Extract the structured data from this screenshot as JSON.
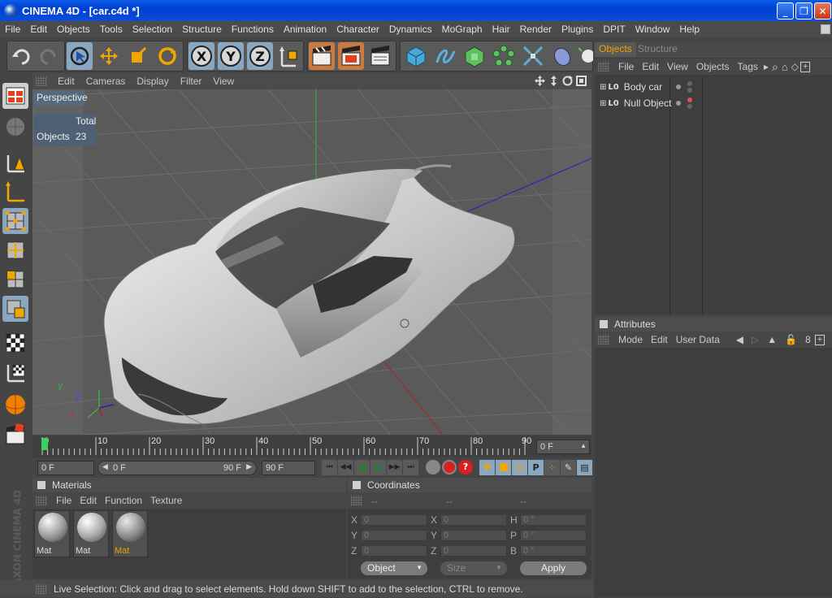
{
  "window": {
    "title": "CINEMA 4D - [car.c4d *]",
    "minimize_glyph": "_",
    "maximize_glyph": "❐",
    "close_glyph": "✕"
  },
  "menu": [
    "File",
    "Edit",
    "Objects",
    "Tools",
    "Selection",
    "Structure",
    "Functions",
    "Animation",
    "Character",
    "Dynamics",
    "MoGraph",
    "Hair",
    "Render",
    "Plugins",
    "DPIT",
    "Window",
    "Help"
  ],
  "toolbar": {
    "icons": [
      "undo-icon",
      "redo-icon",
      "live-selection-icon",
      "move-icon",
      "scale-icon",
      "rotate-icon",
      "x-axis-icon",
      "y-axis-icon",
      "z-axis-icon",
      "coordinate-system-icon",
      "render-view-icon",
      "render-picture-viewer-icon",
      "edit-render-settings-icon",
      "cube-primitive-icon",
      "spline-icon",
      "nurbs-icon",
      "array-icon",
      "deformer-icon",
      "scene-icon",
      "light-icon"
    ],
    "axis_labels": [
      "X",
      "Y",
      "Z"
    ]
  },
  "left_toolbar": {
    "icons": [
      "use-model-icon",
      "use-object-icon",
      "use-points-icon",
      "use-edges-icon",
      "use-polygons-icon",
      "use-axis-icon",
      "use-texture-icon",
      "use-tweak-icon",
      "workplane-icon",
      "solo-icon",
      "material-icon",
      "render-icon"
    ],
    "brand": "MAXON CINEMA 4D"
  },
  "viewport": {
    "menu": [
      "Edit",
      "Cameras",
      "Display",
      "Filter",
      "View"
    ],
    "camera_label": "Perspective",
    "hud": {
      "total_label": "Total",
      "objects_label": "Objects",
      "objects_value": "23"
    },
    "axis_gizmo": {
      "z": "Z",
      "y": "y",
      "x": "x"
    },
    "nav_icons": [
      "pan-icon",
      "zoom-icon",
      "rotate-view-icon",
      "maximize-view-icon"
    ]
  },
  "timeline": {
    "ticks": [
      "0",
      "10",
      "20",
      "30",
      "40",
      "50",
      "60",
      "70",
      "80",
      "90"
    ],
    "current_frame": "0 F"
  },
  "transport": {
    "start_field": "0 F",
    "range_start": "0 F",
    "range_end": "90 F",
    "end_field": "90 F",
    "buttons": [
      "go-to-start-icon",
      "step-back-icon",
      "play-backward-icon",
      "play-forward-icon",
      "step-forward-icon",
      "go-to-end-icon",
      "record-icon",
      "autokey-icon",
      "keyframe-selection-icon"
    ]
  },
  "materials": {
    "title": "Materials",
    "menu": [
      "File",
      "Edit",
      "Function",
      "Texture"
    ],
    "items": [
      {
        "label": "Mat",
        "highlighted": false
      },
      {
        "label": "Mat",
        "highlighted": false
      },
      {
        "label": "Mat",
        "highlighted": true
      }
    ]
  },
  "coordinates": {
    "title": "Coordinates",
    "col_headers": [
      "--",
      "--",
      "--"
    ],
    "rows": [
      {
        "l1": "X",
        "v1": "0",
        "l2": "X",
        "v2": "0",
        "l3": "H",
        "v3": "0 °"
      },
      {
        "l1": "Y",
        "v1": "0",
        "l2": "Y",
        "v2": "0",
        "l3": "P",
        "v3": "0 °"
      },
      {
        "l1": "Z",
        "v1": "0",
        "l2": "Z",
        "v2": "0",
        "l3": "B",
        "v3": "0 °"
      }
    ],
    "mode_select": "Object",
    "size_select": "Size",
    "apply_label": "Apply"
  },
  "objects_panel": {
    "tabs": [
      "Objects",
      "Structure"
    ],
    "menu": [
      "File",
      "Edit",
      "View",
      "Objects",
      "Tags"
    ],
    "items": [
      {
        "name": "Body car",
        "dot_color": "#9a9a9a"
      },
      {
        "name": "Null Object",
        "dot_color": "#e05050"
      }
    ]
  },
  "attributes_panel": {
    "title": "Attributes",
    "menu": [
      "Mode",
      "Edit",
      "User Data"
    ]
  },
  "status": "Live Selection: Click and drag to select elements. Hold down SHIFT to add to the selection, CTRL to remove.",
  "colors": {
    "accent": "#e8a000",
    "selected": "#8aa7c2",
    "panel": "#3e3e3e"
  }
}
